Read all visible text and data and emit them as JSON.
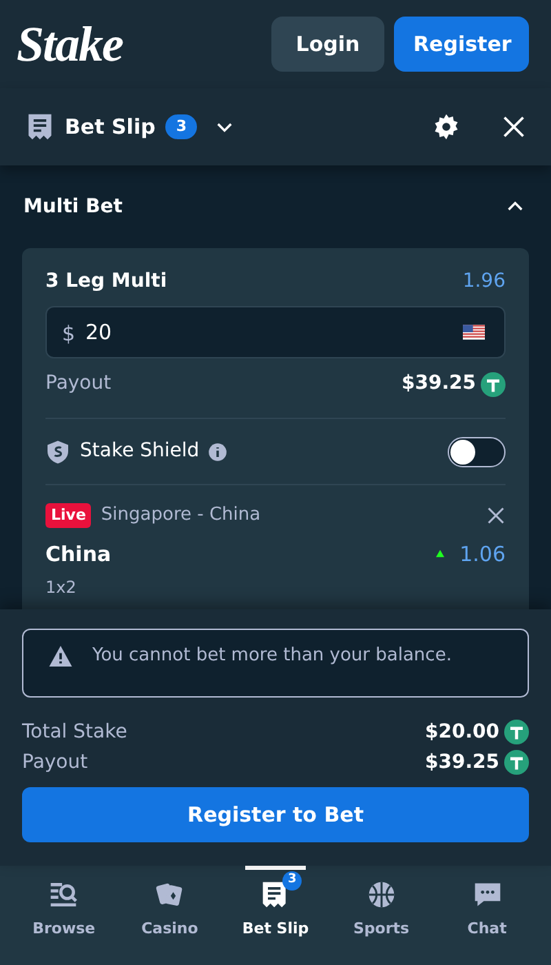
{
  "header": {
    "logo": "Stake",
    "buttons": [
      {
        "label": "Login",
        "kind": "secondary"
      },
      {
        "label": "Register",
        "kind": "primary"
      }
    ]
  },
  "betslip": {
    "title": "Bet Slip",
    "count": "3"
  },
  "section": {
    "title": "Multi Bet",
    "expanded": true
  },
  "multi": {
    "title": "3 Leg Multi",
    "odds": "1.96",
    "currency": "$",
    "amount": "20",
    "payout_label": "Payout",
    "payout": "$39.25",
    "shield_label": "Stake Shield",
    "shield_on": false
  },
  "legs": [
    {
      "live_label": "Live",
      "event": "Singapore - China",
      "selection": "China",
      "odds": "1.06",
      "market": "1x2"
    }
  ],
  "alert": "You cannot bet more than your balance.",
  "totals": [
    {
      "label": "Total Stake",
      "value": "$20.00"
    },
    {
      "label": "Payout",
      "value": "$39.25"
    }
  ],
  "cta": "Register to Bet",
  "nav": [
    {
      "label": "Browse",
      "kind": "browse",
      "selected": false
    },
    {
      "label": "Casino",
      "kind": "casino",
      "selected": false
    },
    {
      "label": "Bet Slip",
      "kind": "slip",
      "selected": true,
      "badge": "3"
    },
    {
      "label": "Sports",
      "kind": "sports",
      "selected": false
    },
    {
      "label": "Chat",
      "kind": "chat",
      "selected": false
    }
  ]
}
